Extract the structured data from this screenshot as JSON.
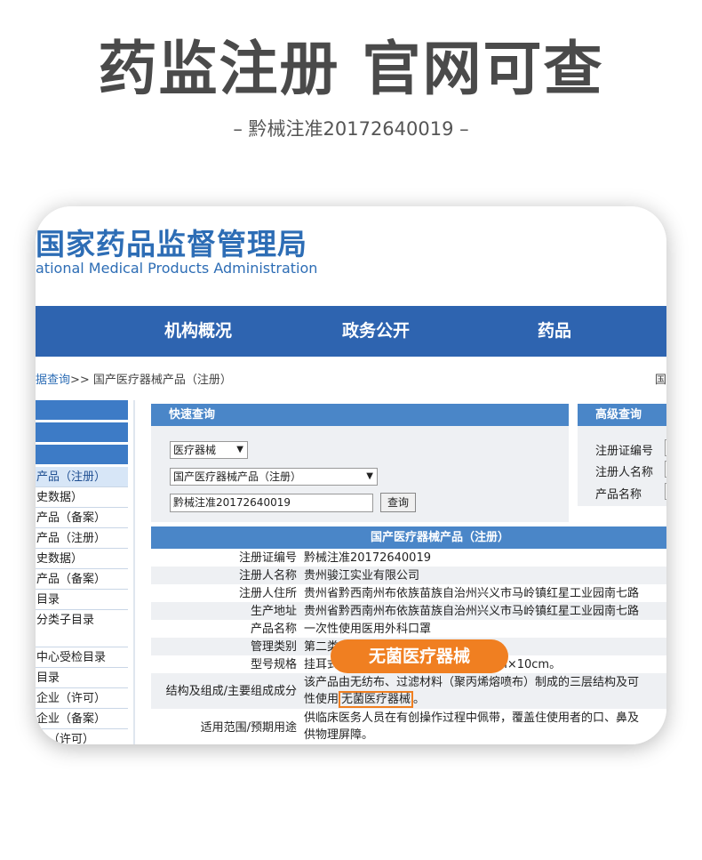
{
  "hero": {
    "title": "药监注册 官网可查",
    "subtitle": "– 黔械注准20172640019 –"
  },
  "site": {
    "logo_cn": "国家药品监督管理局",
    "logo_en": "ational Medical Products Administration",
    "nav": [
      "机构概况",
      "政务公开",
      "药品"
    ],
    "breadcrumb_link": "据查询",
    "breadcrumb_rest": ">> 国产医疗器械产品（注册）",
    "breadcrumb_right": "国"
  },
  "sidebar": {
    "items": [
      "产品（注册）",
      "史数据）",
      "产品（备案）",
      "产品（注册）",
      "史数据）",
      "产品（备案）",
      "目录",
      "分类子目录",
      "中心受检目录",
      "目录",
      "企业（许可）",
      "企业（备案）",
      "业（许可）"
    ]
  },
  "quick_search": {
    "title": "快速查询",
    "category_select": "医疗器械",
    "subcategory_select": "国产医疗器械产品（注册）",
    "query_value": "黔械注准20172640019",
    "query_button": "查询"
  },
  "advanced_search": {
    "title": "高级查询",
    "labels": [
      "注册证编号",
      "注册人名称",
      "产品名称"
    ]
  },
  "result": {
    "title": "国产医疗器械产品（注册）",
    "rows": [
      {
        "key": "注册证编号",
        "value": "黔械注准20172640019"
      },
      {
        "key": "注册人名称",
        "value": "贵州骏江实业有限公司"
      },
      {
        "key": "注册人住所",
        "value": "贵州省黔西南州布依族苗族自治州兴义市马岭镇红星工业园南七路"
      },
      {
        "key": "生产地址",
        "value": "贵州省黔西南州布依族苗族自治州兴义市马岭镇红星工业园南七路"
      },
      {
        "key": "产品名称",
        "value": "一次性使用医用外科口罩"
      },
      {
        "key": "管理类别",
        "value": "第二类"
      },
      {
        "key": "型号规格",
        "value": "挂耳式",
        "value_tail": "cm×10cm。"
      },
      {
        "key": "结构及组成/主要组成成分",
        "value": "该产品由无纺布、过滤材料（聚丙烯熔喷布）制成的三层结构及可",
        "value2_prefix": "性使用",
        "value2_highlight": "无菌医疗器械",
        "value2_suffix": "。"
      },
      {
        "key": "适用范围/预期用途",
        "value": "供临床医务人员在有创操作过程中佩带，覆盖住使用者的口、鼻及",
        "value2": "供物理屏障。"
      }
    ]
  },
  "highlight_tag": "无菌医疗器械",
  "colors": {
    "nav_blue": "#2e64b0",
    "panel_blue": "#4a86c8",
    "accent_orange": "#f07f21"
  }
}
